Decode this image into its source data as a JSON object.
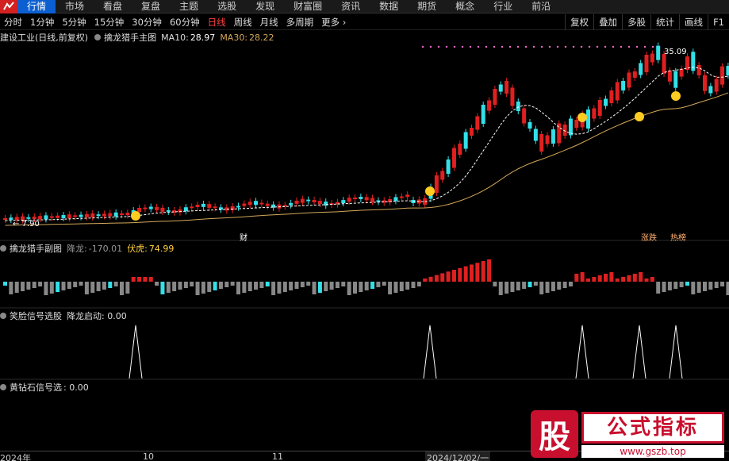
{
  "topnav": {
    "items": [
      "行情",
      "市场",
      "看盘",
      "复盘",
      "主题",
      "选股",
      "发现",
      "财富圈",
      "资讯",
      "数据",
      "期货",
      "概念",
      "行业",
      "前沿"
    ],
    "active_index": 0
  },
  "toolbar": {
    "periods": [
      "分时",
      "1分钟",
      "5分钟",
      "15分钟",
      "30分钟",
      "60分钟",
      "日线",
      "周线",
      "月线",
      "多周期",
      "更多 ›"
    ],
    "selected_index": 6,
    "right": [
      "复权",
      "叠加",
      "多股",
      "统计",
      "画线",
      "F1"
    ]
  },
  "main_legend": {
    "stock": "建设工业(日线,前复权)",
    "indicator": "擒龙猎手主图",
    "ma10_label": "MA10:",
    "ma10_value": "28.97",
    "ma30_label": "MA30:",
    "ma30_value": "28.22",
    "price_high": "35.09",
    "price_low": "7.90",
    "markers": {
      "cai": "财",
      "zhangdie": "涨跌",
      "hot": "热榜"
    }
  },
  "sub1_legend": {
    "title": "擒龙猎手副图",
    "jianglong_label": "降龙:",
    "jianglong_value": "-170.01",
    "fuhu_label": "伏虎:",
    "fuhu_value": "74.99"
  },
  "sub2_legend": {
    "title": "笑脸信号选股",
    "item": "降龙启动: 0.00"
  },
  "sub3_legend": {
    "title": "黄钻石信号选",
    "item": ": 0.00"
  },
  "xaxis": {
    "labels": [
      "2024年",
      "10",
      "11",
      "2024/12/02/一"
    ]
  },
  "watermark": {
    "char": "股",
    "title": "公式指标",
    "url": "www.gszb.top"
  },
  "colors": {
    "up": "#e02020",
    "down": "#33e0e8",
    "ma10": "#ffffff",
    "ma30": "#d4a85a",
    "signal": "#ffffff"
  },
  "chart_data": {
    "type": "candlestick",
    "price_high_label": 35.09,
    "price_low_label": 7.9,
    "ma10_last": 28.97,
    "ma30_last": 28.22,
    "sub_bar_start": -1
  }
}
